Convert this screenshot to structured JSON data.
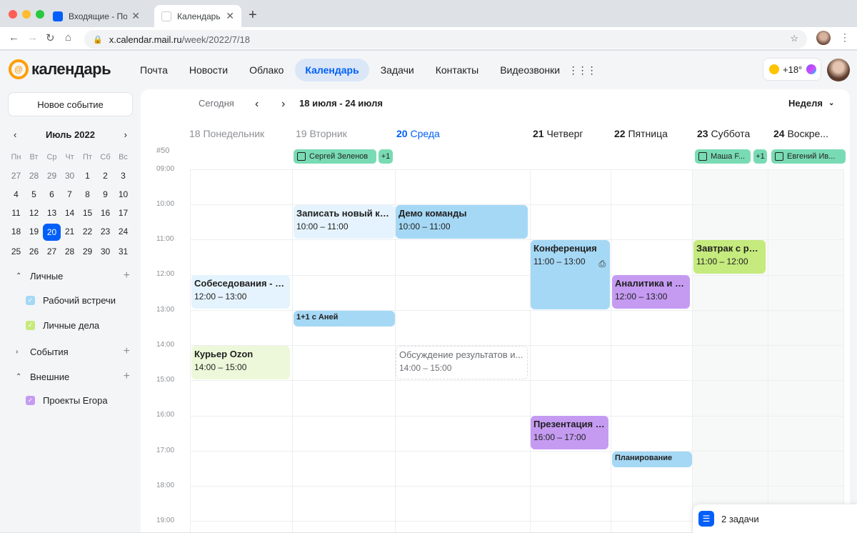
{
  "browser": {
    "tabs": [
      {
        "title": "Входящие - По...",
        "active": false
      },
      {
        "title": "Календарь",
        "active": true
      }
    ],
    "url_host": "x.calendar.mail.ru",
    "url_path": "/week/2022/7/18"
  },
  "header": {
    "logo_text": "календарь",
    "nav": [
      "Почта",
      "Новости",
      "Облако",
      "Календарь",
      "Задачи",
      "Контакты",
      "Видеозвонки"
    ],
    "active_nav": "Календарь",
    "weather_temp": "+18°"
  },
  "sidebar": {
    "new_event": "Новое событие",
    "month_title": "Июль 2022",
    "weekdays": [
      "Пн",
      "Вт",
      "Ср",
      "Чт",
      "Пт",
      "Сб",
      "Вс"
    ],
    "days": [
      "27",
      "28",
      "29",
      "30",
      "1",
      "2",
      "3",
      "4",
      "5",
      "6",
      "7",
      "8",
      "9",
      "10",
      "11",
      "12",
      "13",
      "14",
      "15",
      "16",
      "17",
      "18",
      "19",
      "20",
      "21",
      "22",
      "23",
      "24",
      "25",
      "26",
      "27",
      "28",
      "29",
      "30",
      "31"
    ],
    "today": "20",
    "sections": [
      {
        "label": "Личные",
        "expanded": true
      },
      {
        "label": "События",
        "expanded": false
      },
      {
        "label": "Внешние",
        "expanded": true
      }
    ],
    "calendars": [
      {
        "label": "Рабочий встречи",
        "color": "#a5d8f5"
      },
      {
        "label": "Личные дела",
        "color": "#c5ea7d"
      },
      {
        "label": "Проекты Егора",
        "color": "#c59bf2"
      }
    ]
  },
  "controls": {
    "today": "Сегодня",
    "range": "18 июля - 24 июля",
    "view": "Неделя"
  },
  "week_number": "#50",
  "days": [
    {
      "num": "18",
      "name": "Понедельник"
    },
    {
      "num": "19",
      "name": "Вторник"
    },
    {
      "num": "20",
      "name": "Среда"
    },
    {
      "num": "21",
      "name": "Четверг"
    },
    {
      "num": "22",
      "name": "Пятница"
    },
    {
      "num": "23",
      "name": "Суббота"
    },
    {
      "num": "24",
      "name": "Воскре..."
    }
  ],
  "all_day": [
    {
      "label": "Сергей Зеленов"
    },
    {
      "label": "+1"
    },
    {
      "label": "Маша F..."
    },
    {
      "label": "+1"
    },
    {
      "label": "Евгений Ив..."
    }
  ],
  "hours": [
    "09:00",
    "10:00",
    "11:00",
    "12:00",
    "13:00",
    "14:00",
    "15:00",
    "16:00",
    "17:00",
    "18:00",
    "19:00"
  ],
  "events": [
    {
      "title": "Записать новый кас...",
      "time": "10:00 – 11:00"
    },
    {
      "title": "Демо команды",
      "time": "10:00 – 11:00"
    },
    {
      "title": "Конференция",
      "time": "11:00 – 13:00"
    },
    {
      "title": "Завтрак с род...",
      "time": "11:00 – 12:00"
    },
    {
      "title": "Собеседования - Ви...",
      "time": "12:00 – 13:00"
    },
    {
      "title": "Аналитика и ме...",
      "time": "12:00 – 13:00"
    },
    {
      "title": "1+1 с Аней",
      "time": ""
    },
    {
      "title": "Курьер Ozon",
      "time": "14:00 – 15:00"
    },
    {
      "title": "Обсуждение результатов и...",
      "time": "14:00 – 15:00"
    },
    {
      "title": "Презентация - ...",
      "time": "16:00 – 17:00"
    },
    {
      "title": "Планирование",
      "time": ""
    }
  ],
  "tasks_widget": {
    "label": "2 задачи"
  },
  "colors": {
    "accent": "#005ff9",
    "brand": "#ff9e00"
  }
}
